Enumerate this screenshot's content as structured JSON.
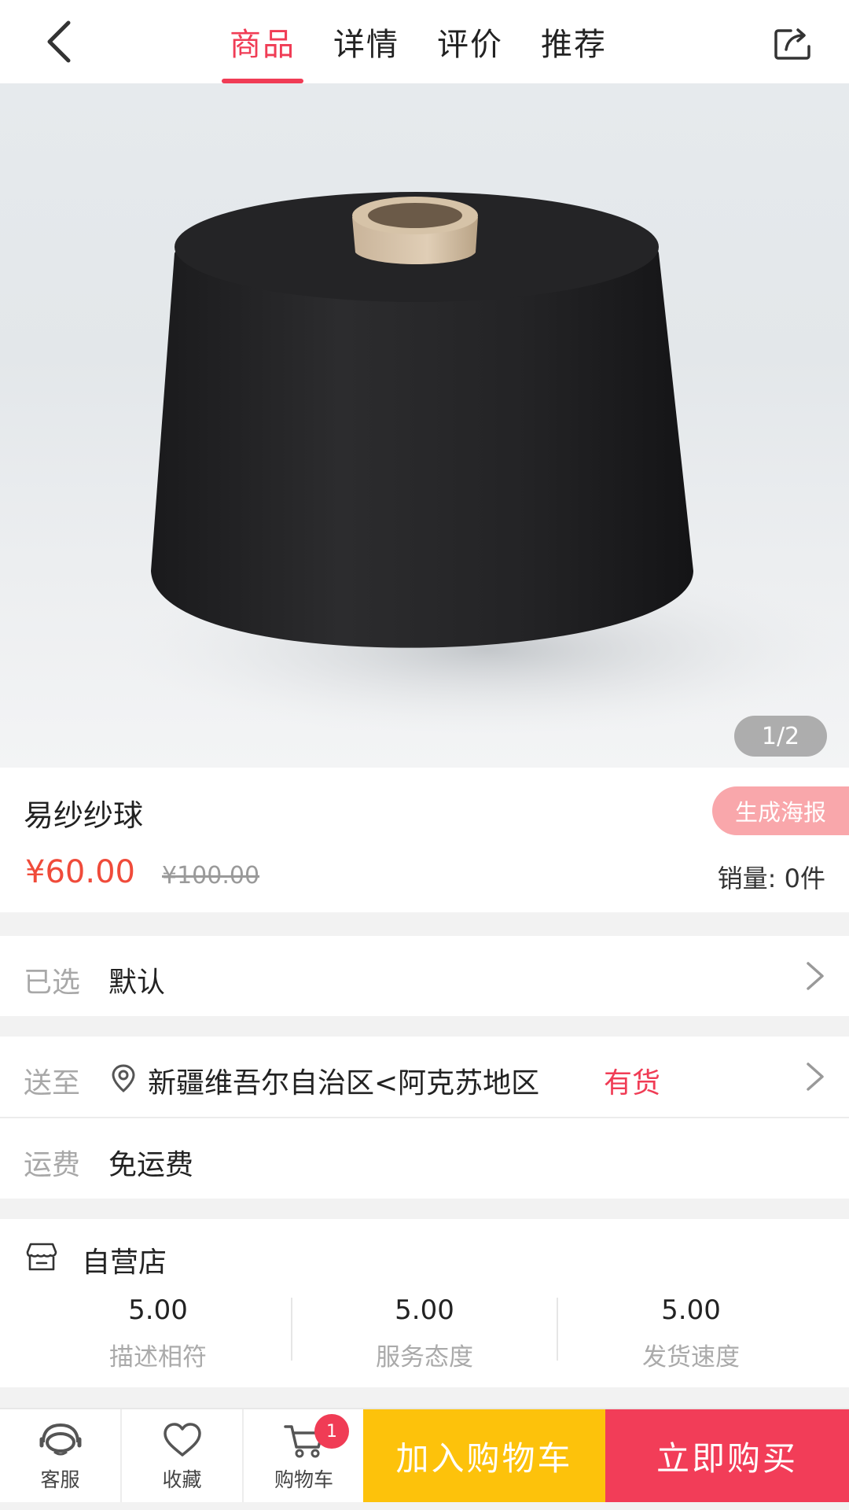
{
  "nav": {
    "tabs": [
      {
        "label": "商品",
        "active": true
      },
      {
        "label": "详情",
        "active": false
      },
      {
        "label": "评价",
        "active": false
      },
      {
        "label": "推荐",
        "active": false
      }
    ],
    "back_icon": "chevron-left-icon",
    "share_icon": "share-icon"
  },
  "hero": {
    "pager": "1/2",
    "image": "black-yarn-cone"
  },
  "product": {
    "name": "易纱纱球",
    "poster_button": "生成海报",
    "price": "¥60.00",
    "original_price": "¥100.00",
    "sales": "销量: 0件"
  },
  "selected": {
    "label": "已选",
    "value": "默认"
  },
  "delivery": {
    "label": "送至",
    "address": "新疆维吾尔自治区<阿克苏地区",
    "stock": "有货",
    "icon": "location-pin-icon"
  },
  "shipping": {
    "label": "运费",
    "value": "免运费"
  },
  "store": {
    "name": "自营店",
    "icon": "store-icon",
    "ratings": [
      {
        "value": "5.00",
        "label": "描述相符"
      },
      {
        "value": "5.00",
        "label": "服务态度"
      },
      {
        "value": "5.00",
        "label": "发货速度"
      }
    ]
  },
  "bottom": {
    "service": "客服",
    "favorite": "收藏",
    "cart": "购物车",
    "cart_badge": "1",
    "add_to_cart": "加入购物车",
    "buy_now": "立即购买"
  },
  "colors": {
    "accent": "#f03c55",
    "price": "#f04b3a",
    "cart_button": "#fdc20b",
    "buy_button": "#f23d58"
  }
}
